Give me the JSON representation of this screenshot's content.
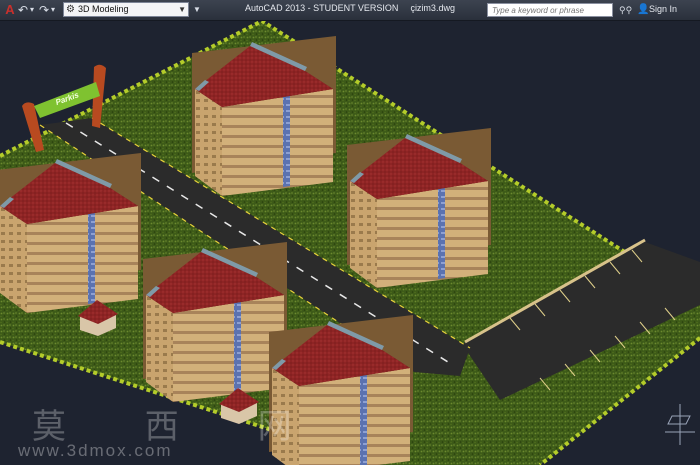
{
  "titlebar": {
    "workspace": "3D Modeling",
    "app_title": "AutoCAD 2013 - STUDENT VERSION",
    "file_name": "çizim3.dwg",
    "search_placeholder": "Type a keyword or phrase",
    "sign_in": "Sign In"
  },
  "icons": {
    "app": "autocad-logo",
    "undo": "undo-arrow",
    "redo": "redo-arrow",
    "workspace": "gear",
    "binoculars": "binoculars",
    "user": "user"
  },
  "scene": {
    "entrance_sign": "Parkis",
    "watermark_chinese": "莫 西 网",
    "watermark_url": "www.3dmox.com"
  },
  "colors": {
    "background": "#1e2330",
    "grass": "#3d5a18",
    "border_strip": "#b4cc2a",
    "road": "#2b2b2b",
    "roof": "#8e2424",
    "wall": "#c9a46e",
    "window_strip": "#5b72b0",
    "arch": "#b84a20",
    "sign": "#7fc230"
  }
}
